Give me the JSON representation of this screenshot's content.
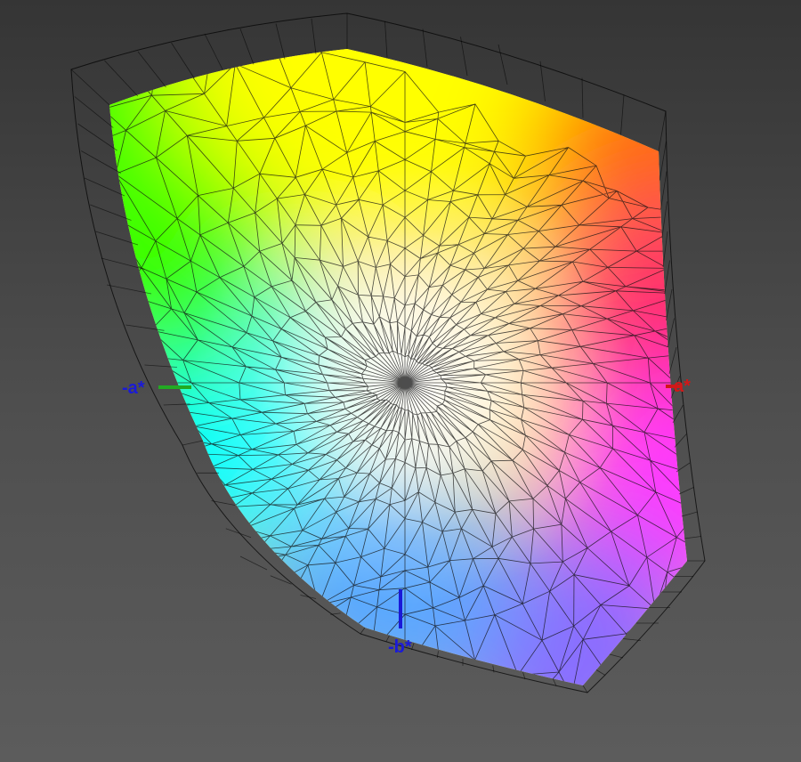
{
  "view": {
    "title": "",
    "background_color": "#4a4a4a",
    "wireframe_color": "#000000"
  },
  "axes": {
    "neg_a": {
      "label": "-a*",
      "color": "#1a1ad8",
      "line_color": "#22aa22"
    },
    "neg_b": {
      "label": "-b*",
      "color": "#1a1ad8",
      "line_color": "#1a1ad8"
    },
    "pos_a": {
      "label": "a*",
      "color": "#d01818",
      "line_color": "#d01818"
    }
  },
  "gamut_colors": {
    "green": "#3bff00",
    "yellow": "#ffff00",
    "orange": "#ff6a00",
    "red": "#ff2a6a",
    "magenta": "#ff38ff",
    "violet": "#8a6cff",
    "blue": "#5aa8ff",
    "cyan": "#00ffff",
    "white": "#ffffff"
  }
}
